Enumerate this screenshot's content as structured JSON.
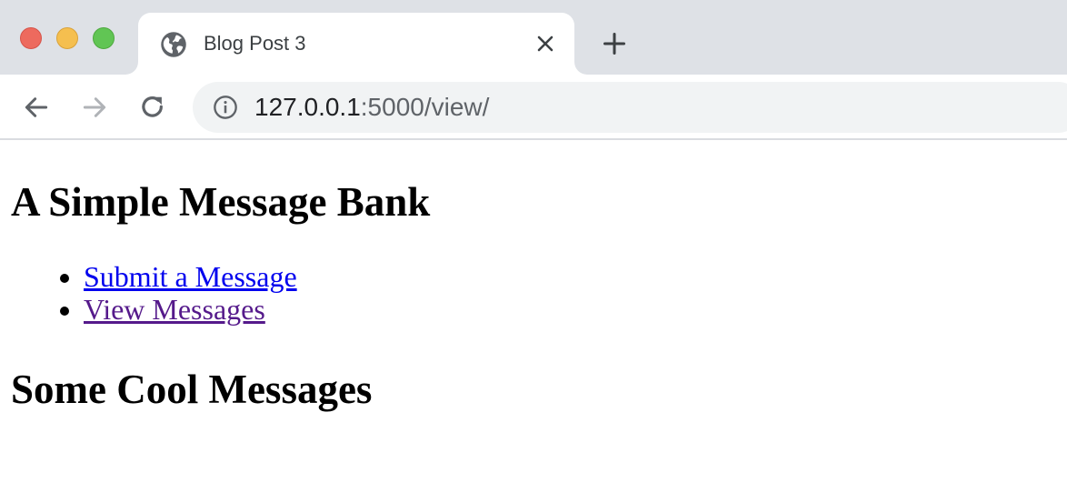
{
  "window": {
    "tab": {
      "title": "Blog Post 3",
      "favicon_icon": "globe-icon",
      "close_icon": "close-icon"
    },
    "new_tab_icon": "plus-icon"
  },
  "toolbar": {
    "back_icon": "arrow-left-icon",
    "forward_icon": "arrow-right-icon",
    "reload_icon": "reload-icon",
    "address": {
      "info_icon": "info-icon",
      "host": "127.0.0.1",
      "rest": ":5000/view/"
    }
  },
  "page": {
    "heading": "A Simple Message Bank",
    "nav_links": [
      {
        "label": "Submit a Message",
        "color": "#0000ee"
      },
      {
        "label": "View Messages",
        "color": "#551a8b"
      }
    ],
    "section_heading": "Some Cool Messages"
  },
  "colors": {
    "tabstrip": "#dee1e6",
    "omnibox": "#f1f3f4",
    "traffic_red": "#ed6a5e",
    "traffic_yellow": "#f5bf4f",
    "traffic_green": "#61c554"
  }
}
